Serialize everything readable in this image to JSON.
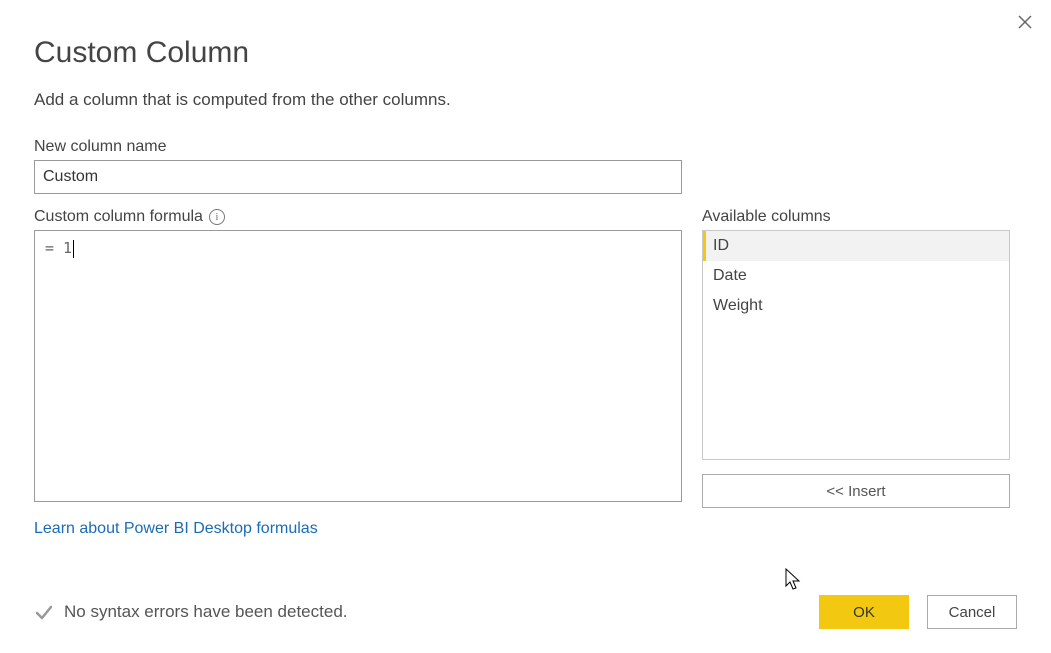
{
  "dialog": {
    "title": "Custom Column",
    "subtitle": "Add a column that is computed from the other columns."
  },
  "name": {
    "label": "New column name",
    "value": "Custom"
  },
  "formula": {
    "label": "Custom column formula",
    "value": "= 1"
  },
  "available": {
    "label": "Available columns",
    "items": [
      "ID",
      "Date",
      "Weight"
    ],
    "selected_index": 0
  },
  "insert_label": "<< Insert",
  "learn_link": "Learn about Power BI Desktop formulas",
  "status_text": "No syntax errors have been detected.",
  "buttons": {
    "ok": "OK",
    "cancel": "Cancel"
  }
}
